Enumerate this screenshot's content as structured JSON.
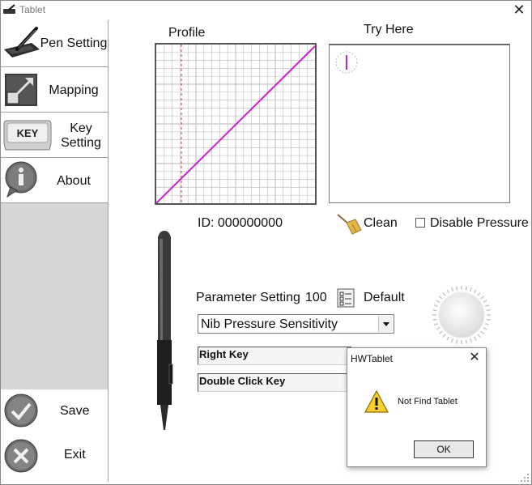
{
  "window": {
    "title": "Tablet",
    "close_glyph": "✕"
  },
  "sidebar": {
    "items": [
      {
        "label": "Pen Setting",
        "icon": "tablet-pen-icon"
      },
      {
        "label": "Mapping",
        "icon": "mapping-arrow-icon"
      },
      {
        "label": "Key\nSetting",
        "icon": "keyboard-key-icon",
        "key_cap": "KEY"
      },
      {
        "label": "About",
        "icon": "info-icon"
      }
    ],
    "save_label": "Save",
    "exit_label": "Exit"
  },
  "profile": {
    "label": "Profile"
  },
  "tryhere": {
    "label": "Try Here"
  },
  "device": {
    "id_text": "ID: 000000000"
  },
  "clean": {
    "label": "Clean"
  },
  "pressure": {
    "disable_label": "Disable Pressure",
    "checked": false
  },
  "parameter": {
    "label": "Parameter Setting",
    "value": "100",
    "default_label": "Default"
  },
  "dropdown": {
    "selected": "Nib Pressure Sensitivity"
  },
  "keys": {
    "right_key": "Right Key",
    "double_click_key": "Double Click Key"
  },
  "dialog": {
    "title": "HWTablet",
    "message": "Not Find Tablet",
    "ok_label": "OK",
    "close_glyph": "✕"
  },
  "colors": {
    "profile_line": "#cc1fd0",
    "grid": "#c4c4c4",
    "sidebar_gray": "#d6d6d6",
    "marker": "#cc1fd0"
  }
}
